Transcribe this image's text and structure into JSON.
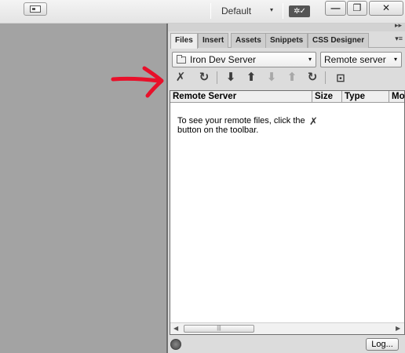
{
  "topbar": {
    "workspace_label": "Default",
    "workspace_caret": "▾",
    "sync_icon": "gear-check-icon",
    "sync_glyph": "✲✓",
    "minimize_glyph": "—",
    "restore_glyph": "❐",
    "close_glyph": "✕"
  },
  "panel": {
    "expand_glyph": "▸▸",
    "tabs": [
      {
        "label": "Files",
        "active": true
      },
      {
        "label": "Insert",
        "active": false
      },
      {
        "label": "Assets",
        "active": false
      },
      {
        "label": "Snippets",
        "active": false
      },
      {
        "label": "CSS Designer",
        "active": false
      }
    ],
    "tab_menu_glyph": "▾≡",
    "site_select": {
      "value": "Iron Dev Server",
      "caret": "▾"
    },
    "view_select": {
      "value": "Remote server",
      "caret": "▾"
    },
    "toolbar": [
      {
        "name": "connect-icon",
        "glyph": "✗",
        "enabled": true
      },
      {
        "name": "refresh-icon",
        "glyph": "↻",
        "enabled": true
      },
      {
        "name": "get-files-icon",
        "glyph": "⬇",
        "enabled": true
      },
      {
        "name": "put-files-icon",
        "glyph": "⬆",
        "enabled": true
      },
      {
        "name": "check-out-icon",
        "glyph": "⬇",
        "enabled": false
      },
      {
        "name": "check-in-icon",
        "glyph": "⬆",
        "enabled": false
      },
      {
        "name": "synchronize-icon",
        "glyph": "↻",
        "enabled": true
      },
      {
        "name": "expand-panel-icon",
        "glyph": "⊡",
        "enabled": true
      }
    ],
    "columns": [
      "Remote Server",
      "Size",
      "Type",
      "Mo"
    ],
    "message": "To see your remote files, click the button on the toolbar.",
    "message_icon_glyph": "✗",
    "scroll_left": "◀",
    "scroll_right": "▶",
    "scroll_thumb_grip": "|||",
    "log_label": "Log..."
  },
  "colors": {
    "workspace_bg": "#a3a3a3",
    "panel_bg": "#dcdcdc",
    "annotation_arrow": "#e8102a"
  }
}
